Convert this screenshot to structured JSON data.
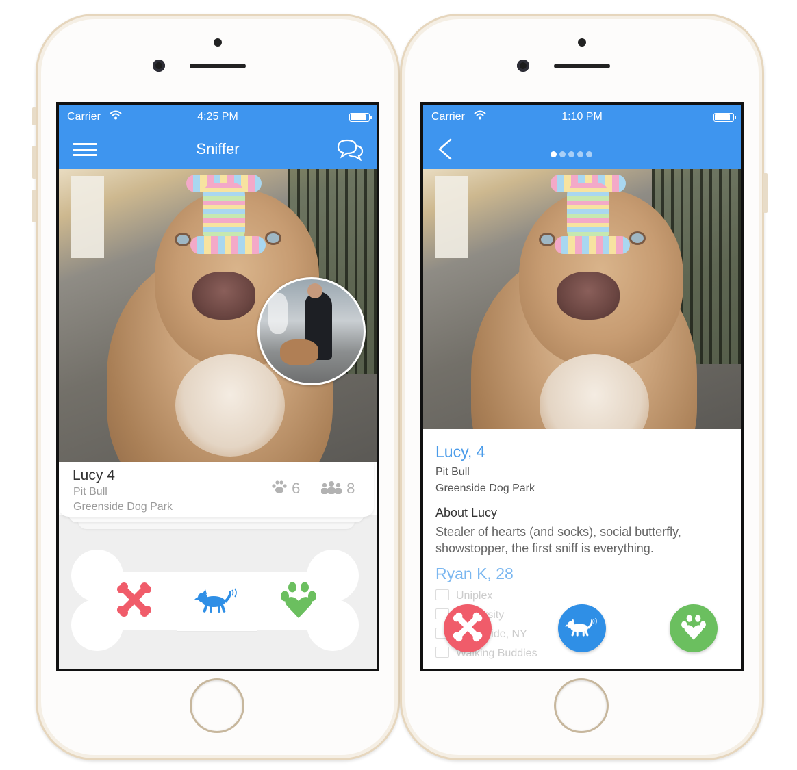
{
  "left_phone": {
    "status": {
      "carrier": "Carrier",
      "time": "4:25 PM"
    },
    "nav": {
      "title": "Sniffer"
    },
    "card": {
      "name": "Lucy 4",
      "breed": "Pit Bull",
      "park": "Greenside Dog Park",
      "paws_count": "6",
      "friends_count": "8"
    },
    "actions": [
      "close-bone-icon",
      "dog-icon",
      "paw-heart-icon"
    ]
  },
  "right_phone": {
    "status": {
      "carrier": "Carrier",
      "time": "1:10 PM"
    },
    "pager": {
      "total": 5,
      "active": 1
    },
    "profile": {
      "name": "Lucy, 4",
      "breed": "Pit Bull",
      "park": "Greenside Dog Park",
      "about_heading": "About Lucy",
      "about_text": "Stealer of hearts (and socks),  social butterfly, showstopper, the first sniff is everything.",
      "owner": "Ryan K, 28",
      "details": [
        "Uniplex",
        "University",
        "West Side, NY",
        "Walking Buddies"
      ]
    }
  },
  "colors": {
    "brand_blue": "#3e95ef",
    "reject_red": "#f05c6a",
    "like_green": "#6bbf5f",
    "sniff_blue": "#2f8fe6"
  }
}
